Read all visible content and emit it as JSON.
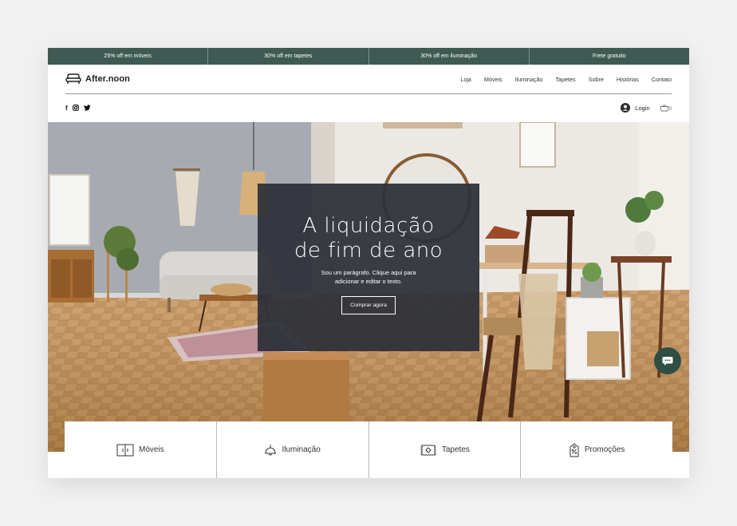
{
  "promo_bar": [
    {
      "label": "25% off em móveis"
    },
    {
      "label": "30% off em tapetes"
    },
    {
      "label": "30% off em iluminação"
    },
    {
      "label": "Frete gratuito"
    }
  ],
  "header": {
    "logo_text": "After.noon",
    "nav": [
      {
        "label": "Loja"
      },
      {
        "label": "Móveis"
      },
      {
        "label": "Iluminação"
      },
      {
        "label": "Tapetes"
      },
      {
        "label": "Sobre"
      },
      {
        "label": "Histórias"
      },
      {
        "label": "Contato"
      }
    ]
  },
  "social": {
    "facebook": "f",
    "instagram": "instagram-icon",
    "twitter": "twitter-icon"
  },
  "account": {
    "login_label": "Login",
    "cart_count": "0"
  },
  "hero": {
    "title_line1": "A liquidação",
    "title_line2": "de fim de ano",
    "paragraph": "Sou um parágrafo. Clique aqui para adicionar e editar o texto.",
    "button_label": "Comprar agora"
  },
  "categories": [
    {
      "label": "Móveis",
      "icon": "cabinet-icon"
    },
    {
      "label": "Iluminação",
      "icon": "lamp-icon"
    },
    {
      "label": "Tapetes",
      "icon": "rug-icon"
    },
    {
      "label": "Promoções",
      "icon": "tag-icon"
    }
  ],
  "colors": {
    "accent": "#3e5a52",
    "overlay": "#2e3138",
    "chat": "#2f4e44"
  }
}
